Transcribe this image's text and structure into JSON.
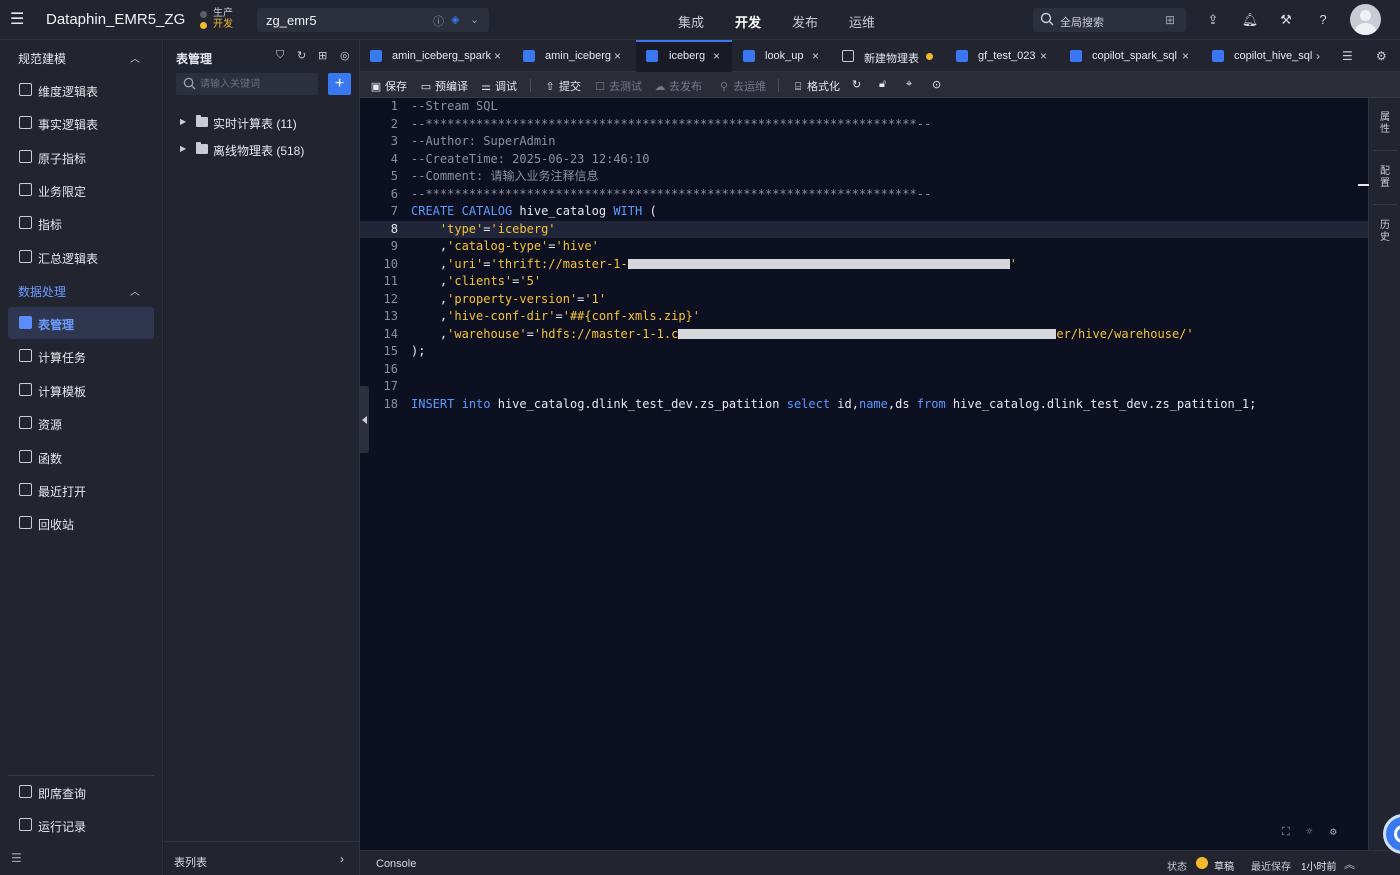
{
  "topbar": {
    "brand": "Dataphin_EMR5_ZG",
    "env": {
      "prod": "生产",
      "dev": "开发"
    },
    "project": "zg_emr5",
    "nav": [
      "集成",
      "开发",
      "发布",
      "运维"
    ],
    "nav_active": 1,
    "search_label": "全局搜索"
  },
  "sidebar": {
    "sections": [
      {
        "title": "规范建模",
        "items": [
          "维度逻辑表",
          "事实逻辑表",
          "原子指标",
          "业务限定",
          "指标",
          "汇总逻辑表"
        ]
      },
      {
        "title": "数据处理",
        "items": [
          "表管理",
          "计算任务",
          "计算模板",
          "资源",
          "函数",
          "最近打开",
          "回收站"
        ]
      }
    ],
    "bottom_items": [
      "即席查询",
      "运行记录"
    ],
    "active_item": "表管理"
  },
  "tree": {
    "title": "表管理",
    "search_placeholder": "请输入关键词",
    "nodes": [
      "实时计算表 (11)",
      "离线物理表 (518)"
    ],
    "footer": "表列表"
  },
  "tabs": [
    {
      "label": "amin_iceberg_spark",
      "closable": true
    },
    {
      "label": "amin_iceberg",
      "closable": true
    },
    {
      "label": "iceberg",
      "closable": true,
      "active": true
    },
    {
      "label": "look_up",
      "closable": true
    },
    {
      "label": "新建物理表",
      "unsaved": true
    },
    {
      "label": "gf_test_023",
      "closable": true
    },
    {
      "label": "copilot_spark_sql",
      "closable": true
    },
    {
      "label": "copilot_hive_sql",
      "closable": false
    }
  ],
  "toolbar": {
    "save": "保存",
    "precompile": "预编译",
    "debug": "调试",
    "submit": "提交",
    "to_test": "去测试",
    "to_publish": "去发布",
    "to_ops": "去运维",
    "format": "格式化"
  },
  "editor": {
    "highlight_line": 8,
    "lines": [
      "--Stream SQL",
      "--********************************************************************--",
      "--Author: SuperAdmin",
      "--CreateTime: 2025-06-23 12:46:10",
      "--Comment: 请输入业务注释信息",
      "--********************************************************************--",
      "CREATE CATALOG hive_catalog WITH (",
      "    'type'='iceberg'",
      "    ,'catalog-type'='hive'",
      "    ,'uri'='thrift://master-1-",
      "    ,'clients'='5'",
      "    ,'property-version'='1'",
      "    ,'hive-conf-dir'='##{conf-xmls.zip}'",
      "    ,'warehouse'='hdfs://master-1-1.c",
      ");",
      "",
      "",
      "INSERT into hive_catalog.dlink_test_dev.zs_patition select id,name,ds from hive_catalog.dlink_test_dev.zs_patition_1;"
    ],
    "line14_tail": "er/hive/warehouse/'"
  },
  "right_panel": [
    "属性",
    "配置",
    "历史"
  ],
  "statusbar": {
    "console": "Console",
    "state_label": "状态",
    "state_value": "草稿",
    "last_saved_label": "最近保存",
    "last_saved_value": "1小时前"
  },
  "colors": {
    "accent": "#3a78f2",
    "editor_bg": "#0d1021",
    "keyword": "#5b9bff",
    "string": "#f5c23b",
    "draft": "#f5b82e"
  }
}
